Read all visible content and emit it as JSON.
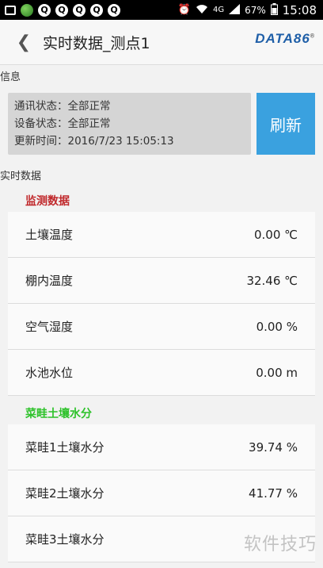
{
  "status_bar": {
    "network": "4G",
    "battery": "67%",
    "time": "15:08"
  },
  "header": {
    "title": "实时数据_测点1",
    "logo": "DATA86",
    "logo_mark": "®"
  },
  "info": {
    "section_label": "信息",
    "comm_status": "通讯状态：全部正常",
    "device_status": "设备状态：全部正常",
    "update_time": "更新时间：2016/7/23 15:05:13",
    "refresh_label": "刷新"
  },
  "realtime": {
    "section_label": "实时数据",
    "groups": [
      {
        "title": "监测数据",
        "rows": [
          {
            "label": "土壤温度",
            "value": "0.00 ℃"
          },
          {
            "label": "棚内温度",
            "value": "32.46 ℃"
          },
          {
            "label": "空气湿度",
            "value": "0.00 %"
          },
          {
            "label": "水池水位",
            "value": "0.00 m"
          }
        ]
      },
      {
        "title": "菜畦土壤水分",
        "rows": [
          {
            "label": "菜畦1土壤水分",
            "value": "39.74 %"
          },
          {
            "label": "菜畦2土壤水分",
            "value": "41.77 %"
          },
          {
            "label": "菜畦3土壤水分",
            "value": ""
          }
        ]
      }
    ]
  },
  "watermark": "软件技巧",
  "colors": {
    "accent_blue": "#3aa1df",
    "group_red": "#c0282b",
    "group_green": "#2ec22b",
    "logo_blue": "#1f5fa8"
  }
}
